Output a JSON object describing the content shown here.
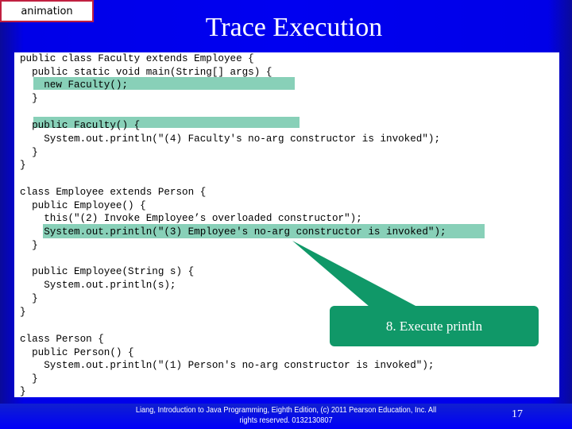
{
  "slide": {
    "animation_label": "animation",
    "title": "Trace Execution",
    "callout": "8. Execute println",
    "footer": {
      "line1": "Liang, Introduction to Java Programming, Eighth Edition, (c) 2011 Pearson Education, Inc. All",
      "line2": "rights reserved. 0132130807"
    },
    "page_number": "17"
  },
  "code": {
    "lines": [
      "public class Faculty extends Employee {",
      "  public static void main(String[] args) {",
      "    new Faculty();",
      "  }",
      "",
      "  public Faculty() {",
      "    System.out.println(\"(4) Faculty's no-arg constructor is invoked\");",
      "  }",
      "}",
      "",
      "class Employee extends Person {",
      "  public Employee() {",
      "    this(\"(2) Invoke Employee’s overloaded constructor\");",
      "    System.out.println(\"(3) Employee's no-arg constructor is invoked\");",
      "  }",
      "",
      "  public Employee(String s) {",
      "    System.out.println(s);",
      "  }",
      "}",
      "",
      "class Person {",
      "  public Person() {",
      "    System.out.println(\"(1) Person's no-arg constructor is invoked\");",
      "  }",
      "}"
    ],
    "highlighted_lines": [
      2,
      5,
      13
    ],
    "current_line": 13
  },
  "colors": {
    "background": "#0000f0",
    "highlight": "#88d0b8",
    "callout": "#109868",
    "animation_border": "#c02040"
  }
}
